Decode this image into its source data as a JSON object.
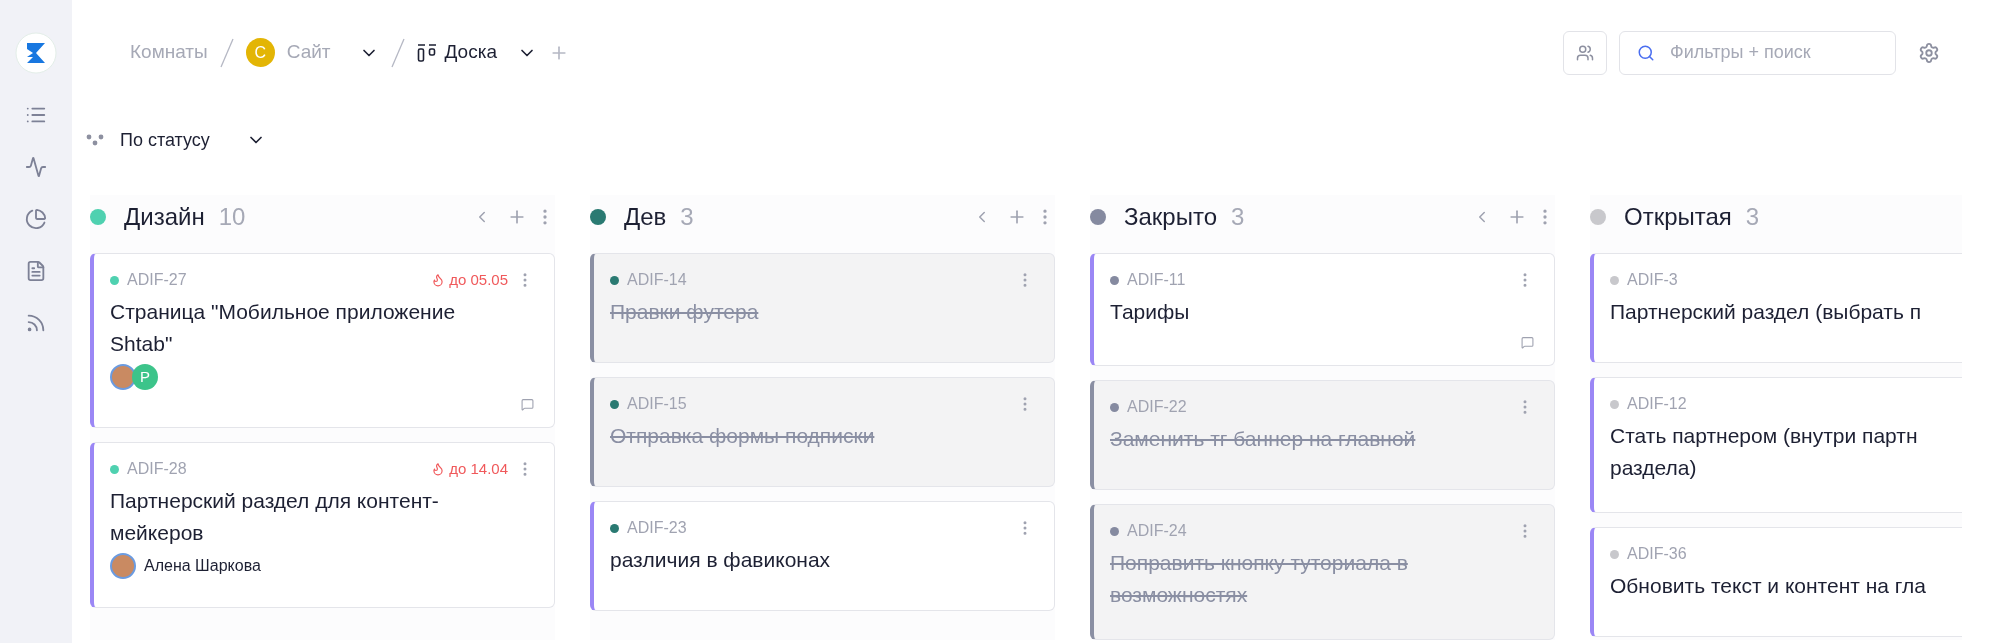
{
  "breadcrumb": {
    "rooms": "Комнаты",
    "project_letter": "С",
    "project": "Сайт",
    "board": "Доска"
  },
  "search": {
    "placeholder": "Фильтры + поиск"
  },
  "group_by": "По статусу",
  "columns": [
    {
      "title": "Дизайн",
      "count": "10",
      "color": "#4fd1b0",
      "clipped": false,
      "cards": [
        {
          "id": "ADIF-27",
          "due": "до 05.05",
          "title": "Страница \"Мобильное приложение Shtab\"",
          "done": false,
          "avatars": [
            {
              "kind": "photo"
            },
            {
              "kind": "letter",
              "letter": "P",
              "color": "#3cc48a"
            }
          ],
          "comment": true
        },
        {
          "id": "ADIF-28",
          "due": "до 14.04",
          "title": "Партнерский раздел для контент-мейкеров",
          "done": false,
          "avatars": [
            {
              "kind": "photo"
            }
          ],
          "assignee": "Алена Шаркова",
          "comment": false
        }
      ]
    },
    {
      "title": "Дев",
      "count": "3",
      "color": "#2a7a72",
      "clipped": false,
      "cards": [
        {
          "id": "ADIF-14",
          "title": "Правки футера",
          "done": true,
          "comment": false
        },
        {
          "id": "ADIF-15",
          "title": "Отправка формы подписки",
          "done": true,
          "comment": false
        },
        {
          "id": "ADIF-23",
          "title": "различия в фавиконах",
          "done": false,
          "comment": false
        }
      ]
    },
    {
      "title": "Закрыто",
      "count": "3",
      "color": "#858aa0",
      "clipped": false,
      "cards": [
        {
          "id": "ADIF-11",
          "title": "Тарифы",
          "done": false,
          "comment": true
        },
        {
          "id": "ADIF-22",
          "title": "Заменить тг баннер на главной",
          "done": true,
          "comment": false
        },
        {
          "id": "ADIF-24",
          "title": "Поправить кнопку туториала в возможностях",
          "done": true,
          "comment": false
        }
      ]
    },
    {
      "title": "Открытая",
      "count": "3",
      "color": "#c8c8cc",
      "clipped": true,
      "cards": [
        {
          "id": "ADIF-3",
          "title": "Партнерский раздел (выбрать п",
          "done": false,
          "comment": false
        },
        {
          "id": "ADIF-12",
          "title": "Стать партнером (внутри партн\nраздела)",
          "done": false,
          "comment": false
        },
        {
          "id": "ADIF-36",
          "title": "Обновить текст и контент на гла",
          "done": false,
          "comment": false
        }
      ]
    }
  ]
}
